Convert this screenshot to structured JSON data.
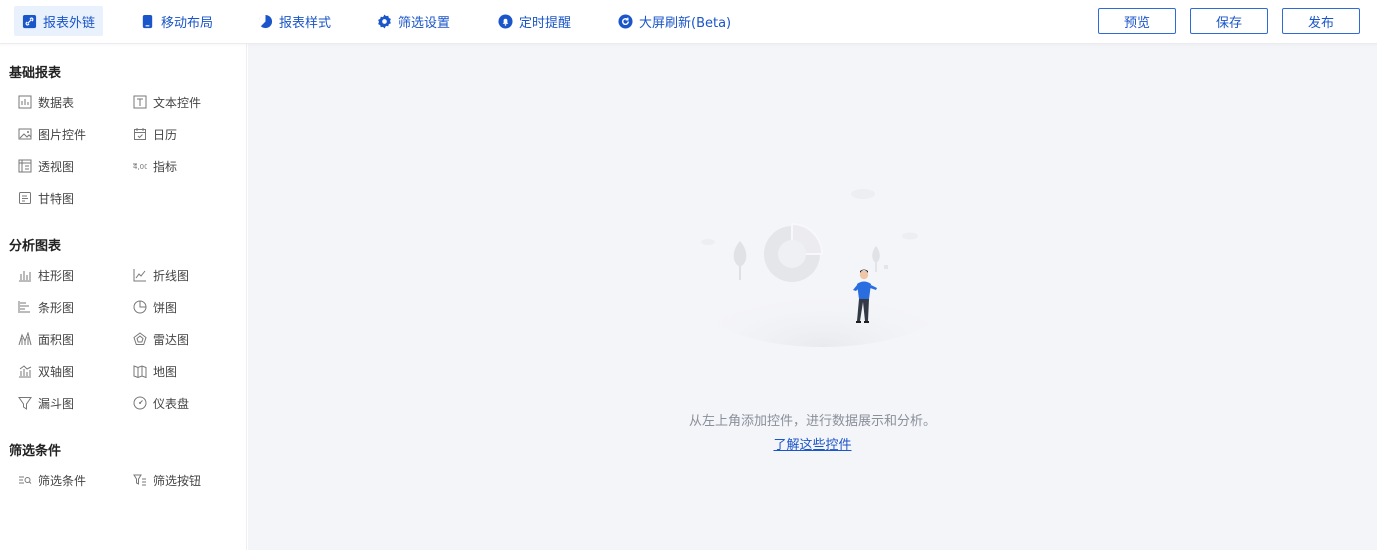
{
  "toolbar": {
    "tabs": [
      {
        "label": "报表外链",
        "icon": "link-icon"
      },
      {
        "label": "移动布局",
        "icon": "mobile-icon"
      },
      {
        "label": "报表样式",
        "icon": "palette-icon"
      },
      {
        "label": "筛选设置",
        "icon": "gear-icon"
      },
      {
        "label": "定时提醒",
        "icon": "bell-icon"
      },
      {
        "label": "大屏刷新(Beta)",
        "icon": "refresh-icon"
      }
    ],
    "preview_label": "预览",
    "save_label": "保存",
    "publish_label": "发布",
    "accent_color": "#1a55c9"
  },
  "sidebar": {
    "basic": {
      "title": "基础报表",
      "items": [
        {
          "label": "数据表",
          "icon": "table-icon"
        },
        {
          "label": "文本控件",
          "icon": "text-icon"
        },
        {
          "label": "图片控件",
          "icon": "image-icon"
        },
        {
          "label": "日历",
          "icon": "calendar-icon"
        },
        {
          "label": "透视图",
          "icon": "pivot-icon"
        },
        {
          "label": "指标",
          "icon": "metric-icon"
        },
        {
          "label": "甘特图",
          "icon": "gantt-icon"
        }
      ]
    },
    "analysis": {
      "title": "分析图表",
      "items": [
        {
          "label": "柱形图",
          "icon": "column-chart-icon"
        },
        {
          "label": "折线图",
          "icon": "line-chart-icon"
        },
        {
          "label": "条形图",
          "icon": "bar-chart-icon"
        },
        {
          "label": "饼图",
          "icon": "pie-chart-icon"
        },
        {
          "label": "面积图",
          "icon": "area-chart-icon"
        },
        {
          "label": "雷达图",
          "icon": "radar-chart-icon"
        },
        {
          "label": "双轴图",
          "icon": "dual-axis-icon"
        },
        {
          "label": "地图",
          "icon": "map-icon"
        },
        {
          "label": "漏斗图",
          "icon": "funnel-icon"
        },
        {
          "label": "仪表盘",
          "icon": "gauge-icon"
        }
      ]
    },
    "filters": {
      "title": "筛选条件",
      "items": [
        {
          "label": "筛选条件",
          "icon": "filter-list-icon"
        },
        {
          "label": "筛选按钮",
          "icon": "filter-button-icon"
        }
      ]
    }
  },
  "canvas": {
    "empty_message": "从左上角添加控件，进行数据展示和分析。",
    "learn_link": "了解这些控件"
  }
}
